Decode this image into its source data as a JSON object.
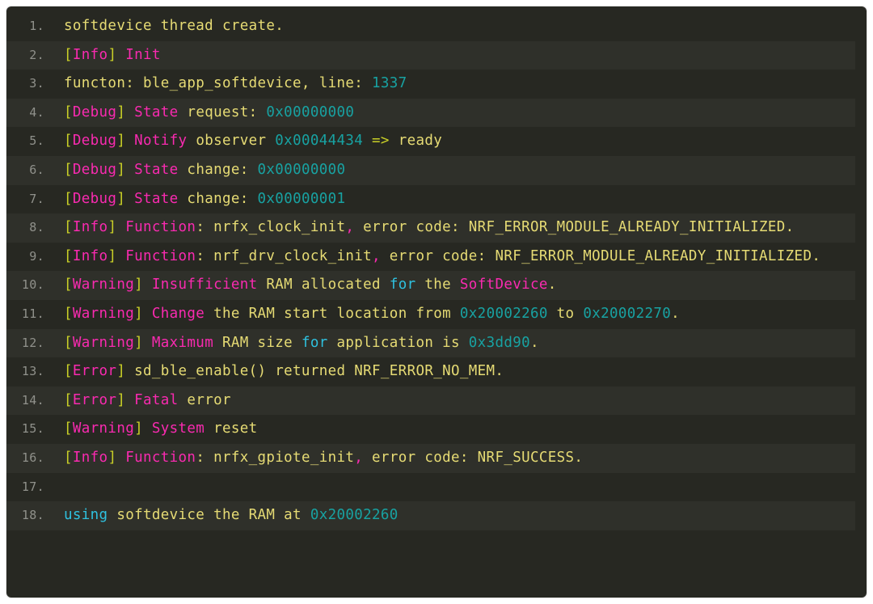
{
  "editor": {
    "name": "log-code-block",
    "background_color": "#272822",
    "alt_row_color": "#2f302a",
    "gutter_color": "#90918b",
    "palette": {
      "plain": "#e6db74",
      "bracket": "#c8cf27",
      "tag": "#f92ab0",
      "number": "#18a2a2",
      "keyword": "#2fc1df",
      "operator": "#c8cf27"
    }
  },
  "lines": [
    {
      "number": "1.",
      "alt": false,
      "tokens": [
        {
          "t": "softdevice thread create.",
          "c": "plain"
        }
      ]
    },
    {
      "number": "2.",
      "alt": true,
      "tokens": [
        {
          "t": "[",
          "c": "bracket"
        },
        {
          "t": "Info",
          "c": "tag"
        },
        {
          "t": "]",
          "c": "bracket"
        },
        {
          "t": " ",
          "c": "plain"
        },
        {
          "t": "Init",
          "c": "tag"
        }
      ]
    },
    {
      "number": "3.",
      "alt": false,
      "tokens": [
        {
          "t": "functon: ble_app_softdevice, line: ",
          "c": "plain"
        },
        {
          "t": "1337",
          "c": "number"
        }
      ]
    },
    {
      "number": "4.",
      "alt": true,
      "tokens": [
        {
          "t": "[",
          "c": "bracket"
        },
        {
          "t": "Debug",
          "c": "tag"
        },
        {
          "t": "]",
          "c": "bracket"
        },
        {
          "t": " ",
          "c": "plain"
        },
        {
          "t": "State",
          "c": "tag"
        },
        {
          "t": " request: ",
          "c": "plain"
        },
        {
          "t": "0x00000000",
          "c": "number"
        }
      ]
    },
    {
      "number": "5.",
      "alt": false,
      "tokens": [
        {
          "t": "[",
          "c": "bracket"
        },
        {
          "t": "Debug",
          "c": "tag"
        },
        {
          "t": "]",
          "c": "bracket"
        },
        {
          "t": " ",
          "c": "plain"
        },
        {
          "t": "Notify",
          "c": "tag"
        },
        {
          "t": " observer ",
          "c": "plain"
        },
        {
          "t": "0x00044434",
          "c": "number"
        },
        {
          "t": " ",
          "c": "plain"
        },
        {
          "t": "=>",
          "c": "operator"
        },
        {
          "t": " ready",
          "c": "plain"
        }
      ]
    },
    {
      "number": "6.",
      "alt": true,
      "tokens": [
        {
          "t": "[",
          "c": "bracket"
        },
        {
          "t": "Debug",
          "c": "tag"
        },
        {
          "t": "]",
          "c": "bracket"
        },
        {
          "t": " ",
          "c": "plain"
        },
        {
          "t": "State",
          "c": "tag"
        },
        {
          "t": " change: ",
          "c": "plain"
        },
        {
          "t": "0x00000000",
          "c": "number"
        }
      ]
    },
    {
      "number": "7.",
      "alt": false,
      "tokens": [
        {
          "t": "[",
          "c": "bracket"
        },
        {
          "t": "Debug",
          "c": "tag"
        },
        {
          "t": "]",
          "c": "bracket"
        },
        {
          "t": " ",
          "c": "plain"
        },
        {
          "t": "State",
          "c": "tag"
        },
        {
          "t": " change: ",
          "c": "plain"
        },
        {
          "t": "0x00000001",
          "c": "number"
        }
      ]
    },
    {
      "number": "8.",
      "alt": true,
      "tokens": [
        {
          "t": "[",
          "c": "bracket"
        },
        {
          "t": "Info",
          "c": "tag"
        },
        {
          "t": "]",
          "c": "bracket"
        },
        {
          "t": " ",
          "c": "plain"
        },
        {
          "t": "Function",
          "c": "tag"
        },
        {
          "t": ": nrfx_clock_init",
          "c": "plain"
        },
        {
          "t": ",",
          "c": "tag"
        },
        {
          "t": " error code: NRF_ERROR_MODULE_ALREADY_INITIALIZED.",
          "c": "plain"
        }
      ]
    },
    {
      "number": "9.",
      "alt": false,
      "tokens": [
        {
          "t": "[",
          "c": "bracket"
        },
        {
          "t": "Info",
          "c": "tag"
        },
        {
          "t": "]",
          "c": "bracket"
        },
        {
          "t": " ",
          "c": "plain"
        },
        {
          "t": "Function",
          "c": "tag"
        },
        {
          "t": ": nrf_drv_clock_init",
          "c": "plain"
        },
        {
          "t": ",",
          "c": "tag"
        },
        {
          "t": " error code: NRF_ERROR_MODULE_ALREADY_INITIALIZED.",
          "c": "plain"
        }
      ]
    },
    {
      "number": "10.",
      "alt": true,
      "tokens": [
        {
          "t": "[",
          "c": "bracket"
        },
        {
          "t": "Warning",
          "c": "tag"
        },
        {
          "t": "]",
          "c": "bracket"
        },
        {
          "t": " ",
          "c": "plain"
        },
        {
          "t": "Insufficient",
          "c": "tag"
        },
        {
          "t": " RAM allocated ",
          "c": "plain"
        },
        {
          "t": "for",
          "c": "keyword"
        },
        {
          "t": " the ",
          "c": "plain"
        },
        {
          "t": "SoftDevice",
          "c": "tag"
        },
        {
          "t": ".",
          "c": "plain"
        }
      ]
    },
    {
      "number": "11.",
      "alt": false,
      "tokens": [
        {
          "t": "[",
          "c": "bracket"
        },
        {
          "t": "Warning",
          "c": "tag"
        },
        {
          "t": "]",
          "c": "bracket"
        },
        {
          "t": " ",
          "c": "plain"
        },
        {
          "t": "Change",
          "c": "tag"
        },
        {
          "t": " the RAM start location from ",
          "c": "plain"
        },
        {
          "t": "0x20002260",
          "c": "number"
        },
        {
          "t": " to ",
          "c": "plain"
        },
        {
          "t": "0x20002270",
          "c": "number"
        },
        {
          "t": ".",
          "c": "plain"
        }
      ]
    },
    {
      "number": "12.",
      "alt": true,
      "tokens": [
        {
          "t": "[",
          "c": "bracket"
        },
        {
          "t": "Warning",
          "c": "tag"
        },
        {
          "t": "]",
          "c": "bracket"
        },
        {
          "t": " ",
          "c": "plain"
        },
        {
          "t": "Maximum",
          "c": "tag"
        },
        {
          "t": " RAM size ",
          "c": "plain"
        },
        {
          "t": "for",
          "c": "keyword"
        },
        {
          "t": " application is ",
          "c": "plain"
        },
        {
          "t": "0x3dd90",
          "c": "number"
        },
        {
          "t": ".",
          "c": "plain"
        }
      ]
    },
    {
      "number": "13.",
      "alt": false,
      "tokens": [
        {
          "t": "[",
          "c": "bracket"
        },
        {
          "t": "Error",
          "c": "tag"
        },
        {
          "t": "]",
          "c": "bracket"
        },
        {
          "t": " sd_ble_enable() returned NRF_ERROR_NO_MEM.",
          "c": "plain"
        }
      ]
    },
    {
      "number": "14.",
      "alt": true,
      "tokens": [
        {
          "t": "[",
          "c": "bracket"
        },
        {
          "t": "Error",
          "c": "tag"
        },
        {
          "t": "]",
          "c": "bracket"
        },
        {
          "t": " ",
          "c": "plain"
        },
        {
          "t": "Fatal",
          "c": "tag"
        },
        {
          "t": " error",
          "c": "plain"
        }
      ]
    },
    {
      "number": "15.",
      "alt": false,
      "tokens": [
        {
          "t": "[",
          "c": "bracket"
        },
        {
          "t": "Warning",
          "c": "tag"
        },
        {
          "t": "]",
          "c": "bracket"
        },
        {
          "t": " ",
          "c": "plain"
        },
        {
          "t": "System",
          "c": "tag"
        },
        {
          "t": " reset",
          "c": "plain"
        }
      ]
    },
    {
      "number": "16.",
      "alt": true,
      "tokens": [
        {
          "t": "[",
          "c": "bracket"
        },
        {
          "t": "Info",
          "c": "tag"
        },
        {
          "t": "]",
          "c": "bracket"
        },
        {
          "t": " ",
          "c": "plain"
        },
        {
          "t": "Function",
          "c": "tag"
        },
        {
          "t": ": nrfx_gpiote_init",
          "c": "plain"
        },
        {
          "t": ",",
          "c": "tag"
        },
        {
          "t": " error code: NRF_SUCCESS.",
          "c": "plain"
        }
      ]
    },
    {
      "number": "17.",
      "alt": false,
      "tokens": []
    },
    {
      "number": "18.",
      "alt": true,
      "tokens": [
        {
          "t": "using",
          "c": "keyword"
        },
        {
          "t": " softdevice the RAM at ",
          "c": "plain"
        },
        {
          "t": "0x20002260",
          "c": "number"
        }
      ]
    }
  ]
}
